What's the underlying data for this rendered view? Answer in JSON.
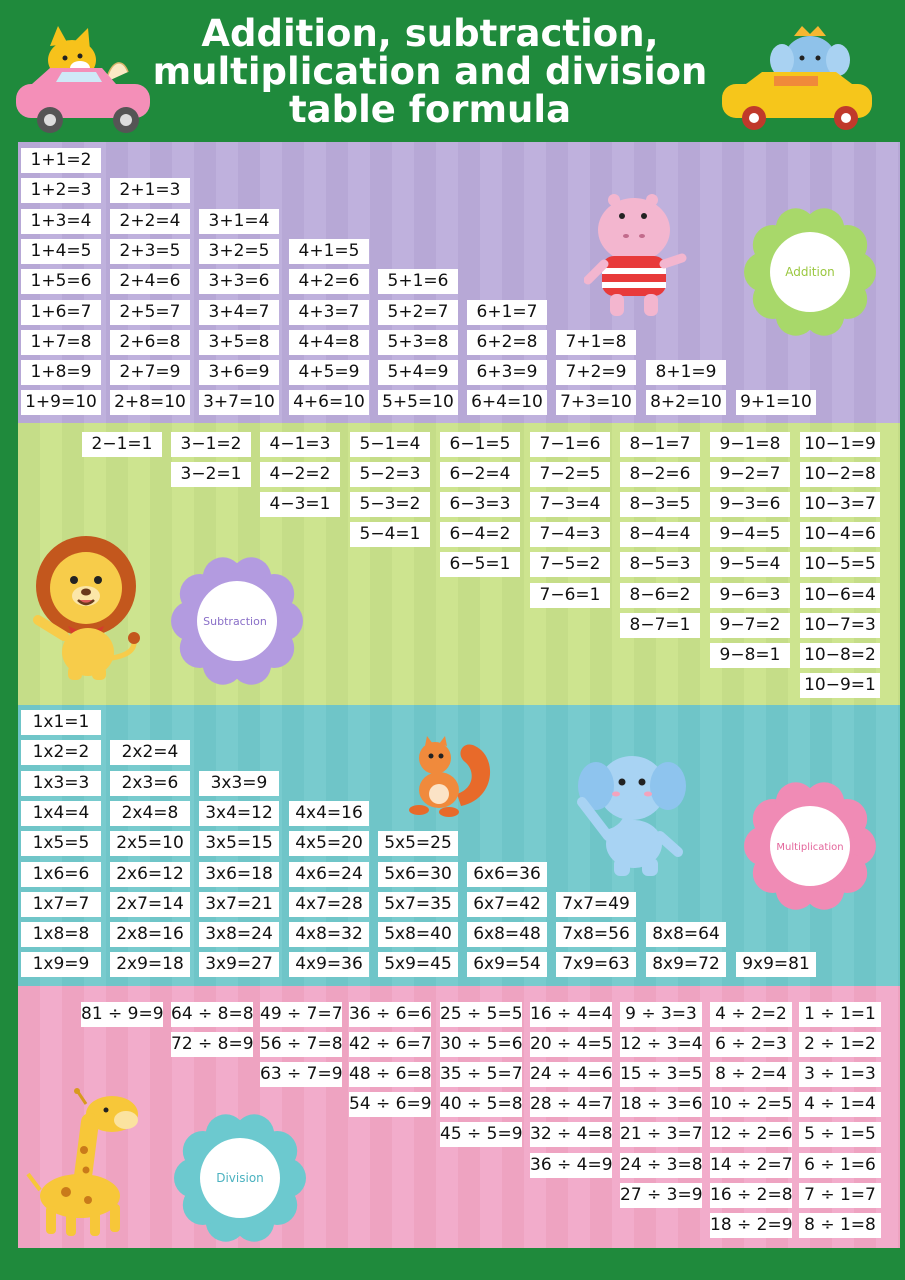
{
  "title": [
    "Addition, subtraction,",
    "multiplication and division",
    "table formula"
  ],
  "badges": {
    "addition": "Addition",
    "subtraction": "Subtraction",
    "multiplication": "Multiplication",
    "division": "Division"
  },
  "colors": {
    "background": "#1f8a3c",
    "addition_panel": "#b7a8d6",
    "subtraction_panel": "#c5dd88",
    "multiplication_panel": "#6fc5c8",
    "division_panel": "#eea3c1",
    "addition_flower": "#a8d86a",
    "subtraction_flower": "#b39be0",
    "multiplication_flower": "#f08bb5",
    "division_flower": "#6cc9cf"
  },
  "icons": [
    "fox-in-pink-car-icon",
    "elephant-in-yellow-car-icon",
    "hippo-icon",
    "lion-icon",
    "squirrel-icon",
    "elephant-icon",
    "giraffe-icon"
  ],
  "addition": [
    [
      "1+1=2"
    ],
    [
      "1+2=3",
      "2+1=3"
    ],
    [
      "1+3=4",
      "2+2=4",
      "3+1=4"
    ],
    [
      "1+4=5",
      "2+3=5",
      "3+2=5",
      "4+1=5"
    ],
    [
      "1+5=6",
      "2+4=6",
      "3+3=6",
      "4+2=6",
      "5+1=6"
    ],
    [
      "1+6=7",
      "2+5=7",
      "3+4=7",
      "4+3=7",
      "5+2=7",
      "6+1=7"
    ],
    [
      "1+7=8",
      "2+6=8",
      "3+5=8",
      "4+4=8",
      "5+3=8",
      "6+2=8",
      "7+1=8"
    ],
    [
      "1+8=9",
      "2+7=9",
      "3+6=9",
      "4+5=9",
      "5+4=9",
      "6+3=9",
      "7+2=9",
      "8+1=9"
    ],
    [
      "1+9=10",
      "2+8=10",
      "3+7=10",
      "4+6=10",
      "5+5=10",
      "6+4=10",
      "7+3=10",
      "8+2=10",
      "9+1=10"
    ]
  ],
  "subtraction": [
    [
      "2−1=1"
    ],
    [
      "3−1=2",
      "3−2=1"
    ],
    [
      "4−1=3",
      "4−2=2",
      "4−3=1"
    ],
    [
      "5−1=4",
      "5−2=3",
      "5−3=2",
      "5−4=1"
    ],
    [
      "6−1=5",
      "6−2=4",
      "6−3=3",
      "6−4=2",
      "6−5=1"
    ],
    [
      "7−1=6",
      "7−2=5",
      "7−3=4",
      "7−4=3",
      "7−5=2",
      "7−6=1"
    ],
    [
      "8−1=7",
      "8−2=6",
      "8−3=5",
      "8−4=4",
      "8−5=3",
      "8−6=2",
      "8−7=1"
    ],
    [
      "9−1=8",
      "9−2=7",
      "9−3=6",
      "9−4=5",
      "9−5=4",
      "9−6=3",
      "9−7=2",
      "9−8=1"
    ],
    [
      "10−1=9",
      "10−2=8",
      "10−3=7",
      "10−4=6",
      "10−5=5",
      "10−6=4",
      "10−7=3",
      "10−8=2",
      "10−9=1"
    ]
  ],
  "multiplication": [
    [
      "1x1=1"
    ],
    [
      "1x2=2",
      "2x2=4"
    ],
    [
      "1x3=3",
      "2x3=6",
      "3x3=9"
    ],
    [
      "1x4=4",
      "2x4=8",
      "3x4=12",
      "4x4=16"
    ],
    [
      "1x5=5",
      "2x5=10",
      "3x5=15",
      "4x5=20",
      "5x5=25"
    ],
    [
      "1x6=6",
      "2x6=12",
      "3x6=18",
      "4x6=24",
      "5x6=30",
      "6x6=36"
    ],
    [
      "1x7=7",
      "2x7=14",
      "3x7=21",
      "4x7=28",
      "5x7=35",
      "6x7=42",
      "7x7=49"
    ],
    [
      "1x8=8",
      "2x8=16",
      "3x8=24",
      "4x8=32",
      "5x8=40",
      "6x8=48",
      "7x8=56",
      "8x8=64"
    ],
    [
      "1x9=9",
      "2x9=18",
      "3x9=27",
      "4x9=36",
      "5x9=45",
      "6x9=54",
      "7x9=63",
      "8x9=72",
      "9x9=81"
    ]
  ],
  "division": [
    [
      "81 ÷ 9=9"
    ],
    [
      "64 ÷ 8=8",
      "72 ÷ 8=9"
    ],
    [
      "49 ÷ 7=7",
      "56 ÷ 7=8",
      "63 ÷ 7=9"
    ],
    [
      "36 ÷ 6=6",
      "42 ÷ 6=7",
      "48 ÷ 6=8",
      "54 ÷ 6=9"
    ],
    [
      "25 ÷ 5=5",
      "30 ÷ 5=6",
      "35 ÷ 5=7",
      "40 ÷ 5=8",
      "45 ÷ 5=9"
    ],
    [
      "16 ÷ 4=4",
      "20 ÷ 4=5",
      "24 ÷ 4=6",
      "28 ÷ 4=7",
      "32 ÷ 4=8",
      "36 ÷ 4=9"
    ],
    [
      "9 ÷ 3=3",
      "12 ÷ 3=4",
      "15 ÷ 3=5",
      "18 ÷ 3=6",
      "21 ÷ 3=7",
      "24 ÷ 3=8",
      "27 ÷ 3=9"
    ],
    [
      "4 ÷ 2=2",
      "6 ÷ 2=3",
      "8 ÷ 2=4",
      "10 ÷ 2=5",
      "12 ÷ 2=6",
      "14 ÷ 2=7",
      "16 ÷ 2=8",
      "18 ÷ 2=9"
    ],
    [
      "1 ÷ 1=1",
      "2 ÷ 1=2",
      "3 ÷ 1=3",
      "4 ÷ 1=4",
      "5 ÷ 1=5",
      "6 ÷ 1=6",
      "7 ÷ 1=7",
      "8 ÷ 1=8"
    ]
  ]
}
